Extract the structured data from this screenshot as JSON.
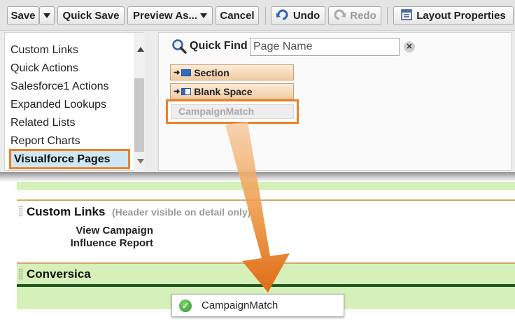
{
  "toolbar": {
    "save_label": "Save",
    "quick_save_label": "Quick Save",
    "preview_as_label": "Preview As...",
    "cancel_label": "Cancel",
    "undo_label": "Undo",
    "redo_label": "Redo",
    "layout_properties_label": "Layout Properties"
  },
  "palette": {
    "categories": [
      "Custom Links",
      "Quick Actions",
      "Salesforce1 Actions",
      "Expanded Lookups",
      "Related Lists",
      "Report Charts",
      "Visualforce Pages"
    ],
    "selected_category": "Visualforce Pages",
    "quick_find_label": "Quick Find",
    "quick_find_placeholder": "Page Name",
    "elements": {
      "section": "Section",
      "blank_space": "Blank Space",
      "campaign_match": "CampaignMatch"
    }
  },
  "layout": {
    "custom_links_title": "Custom Links",
    "custom_links_note": "(Header visible on detail only)",
    "field_line1": "View Campaign",
    "field_line2": "Influence Report",
    "conversica_title": "Conversica",
    "dragged_item": "CampaignMatch"
  },
  "colors": {
    "highlight_orange": "#e8822a",
    "section_green": "#d6f0ba"
  },
  "icons": [
    "dropdown-caret-icon",
    "undo-icon",
    "redo-icon",
    "layout-properties-icon",
    "magnifier-icon",
    "clear-icon",
    "section-icon",
    "blank-space-icon",
    "drag-arrow-icon",
    "checkmark-icon"
  ]
}
